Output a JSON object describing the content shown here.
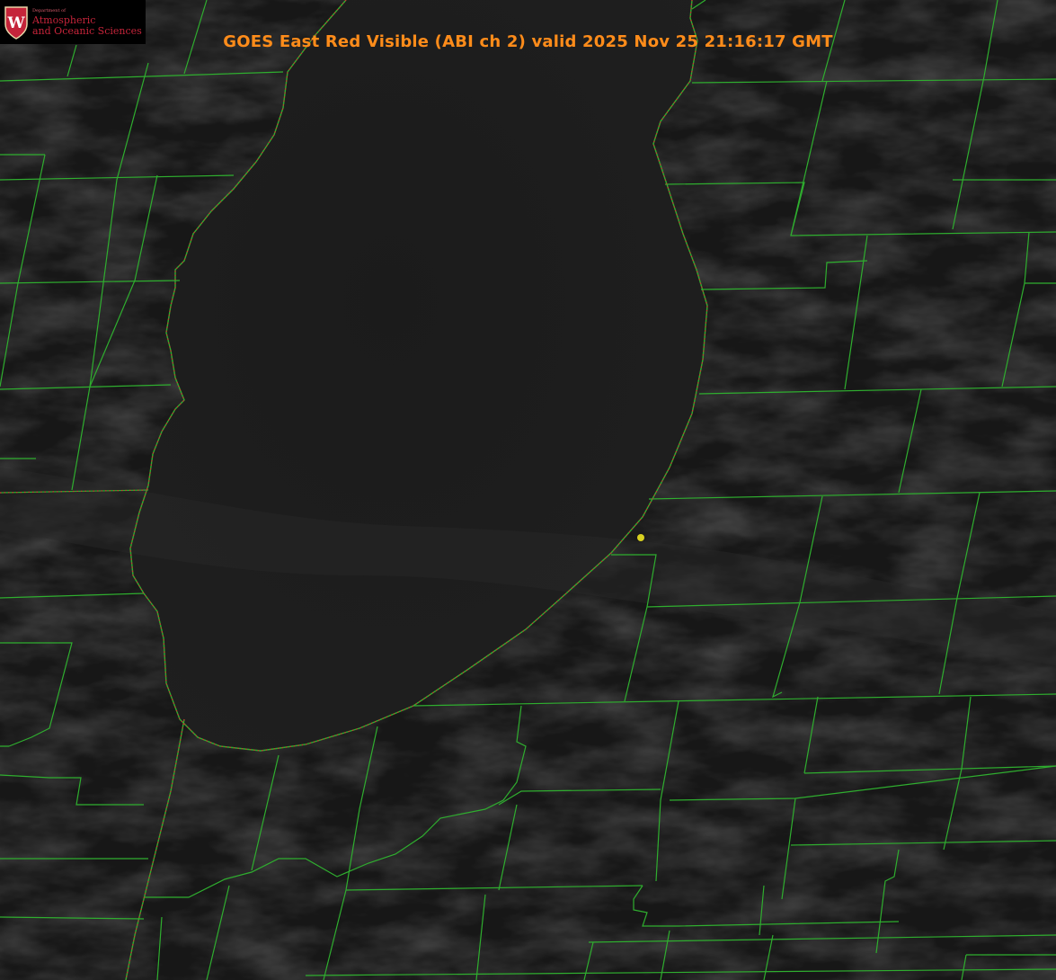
{
  "title": "GOES East Red Visible (ABI ch 2) valid 2025 Nov 25 21:16:17 GMT",
  "logo": {
    "department": "Department of",
    "line1": "Atmospheric",
    "line2": "and Oceanic Sciences",
    "seal_letter": "W"
  },
  "colors": {
    "background": "#151515",
    "lake": "#1c1c1c",
    "boundaries": "#2fae2f",
    "shoreline_dots": "#d03030",
    "title": "#ff8c1a",
    "marker": "#d8d020",
    "logo_text": "#c5243a"
  },
  "icons": {
    "seal": "uw-crest-icon",
    "marker": "location-dot-icon"
  }
}
